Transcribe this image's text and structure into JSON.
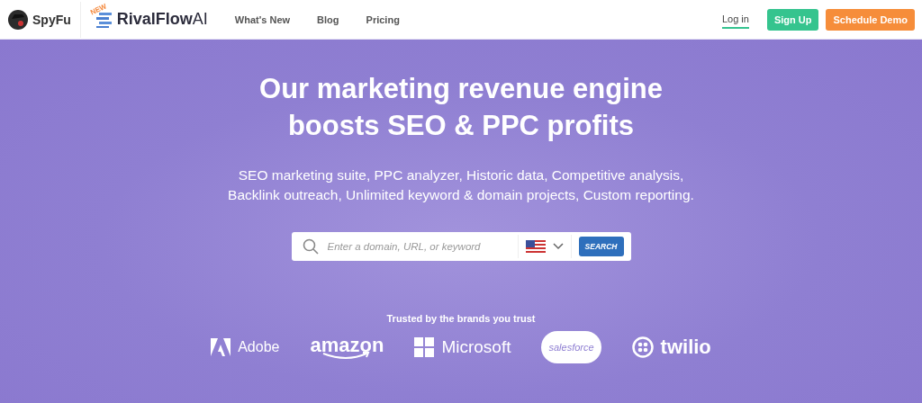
{
  "header": {
    "logo": "SpyFu",
    "product": {
      "badge": "NEW",
      "name": "**RivalFlow**AI"
    },
    "nav": [
      "What's New",
      "Blog",
      "Pricing"
    ],
    "login": "Log in",
    "signup": "Sign Up",
    "demo": "Schedule Demo"
  },
  "hero": {
    "title": [
      "Our marketing revenue engine",
      "boosts SEO & PPC profits"
    ],
    "subtitle": "SEO marketing suite, PPC analyzer, Historic data, Competitive analysis, Backlink outreach, Unlimited keyword & domain projects, Custom reporting.",
    "search": {
      "placeholder": "Enter a domain, URL, or keyword",
      "button": "SEARCH"
    }
  },
  "brands": {
    "caption": "Trusted by the brands you trust",
    "items": [
      {
        "kind": "adobe",
        "name": "Adobe"
      },
      {
        "kind": "amazon",
        "name": "amazon"
      },
      {
        "kind": "microsoft",
        "name": "Microsoft"
      },
      {
        "kind": "salesforce",
        "name": "salesforce"
      },
      {
        "kind": "twilio",
        "name": "twilio"
      }
    ]
  }
}
